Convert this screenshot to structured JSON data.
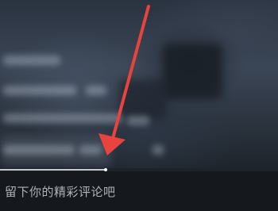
{
  "video": {
    "progress_fraction": 0.38
  },
  "comment": {
    "placeholder": "留下你的精彩评论吧"
  },
  "annotation": {
    "arrow_color": "#e8433c"
  },
  "colors": {
    "background": "#15181c",
    "placeholder_text": "#aeb3ba"
  }
}
